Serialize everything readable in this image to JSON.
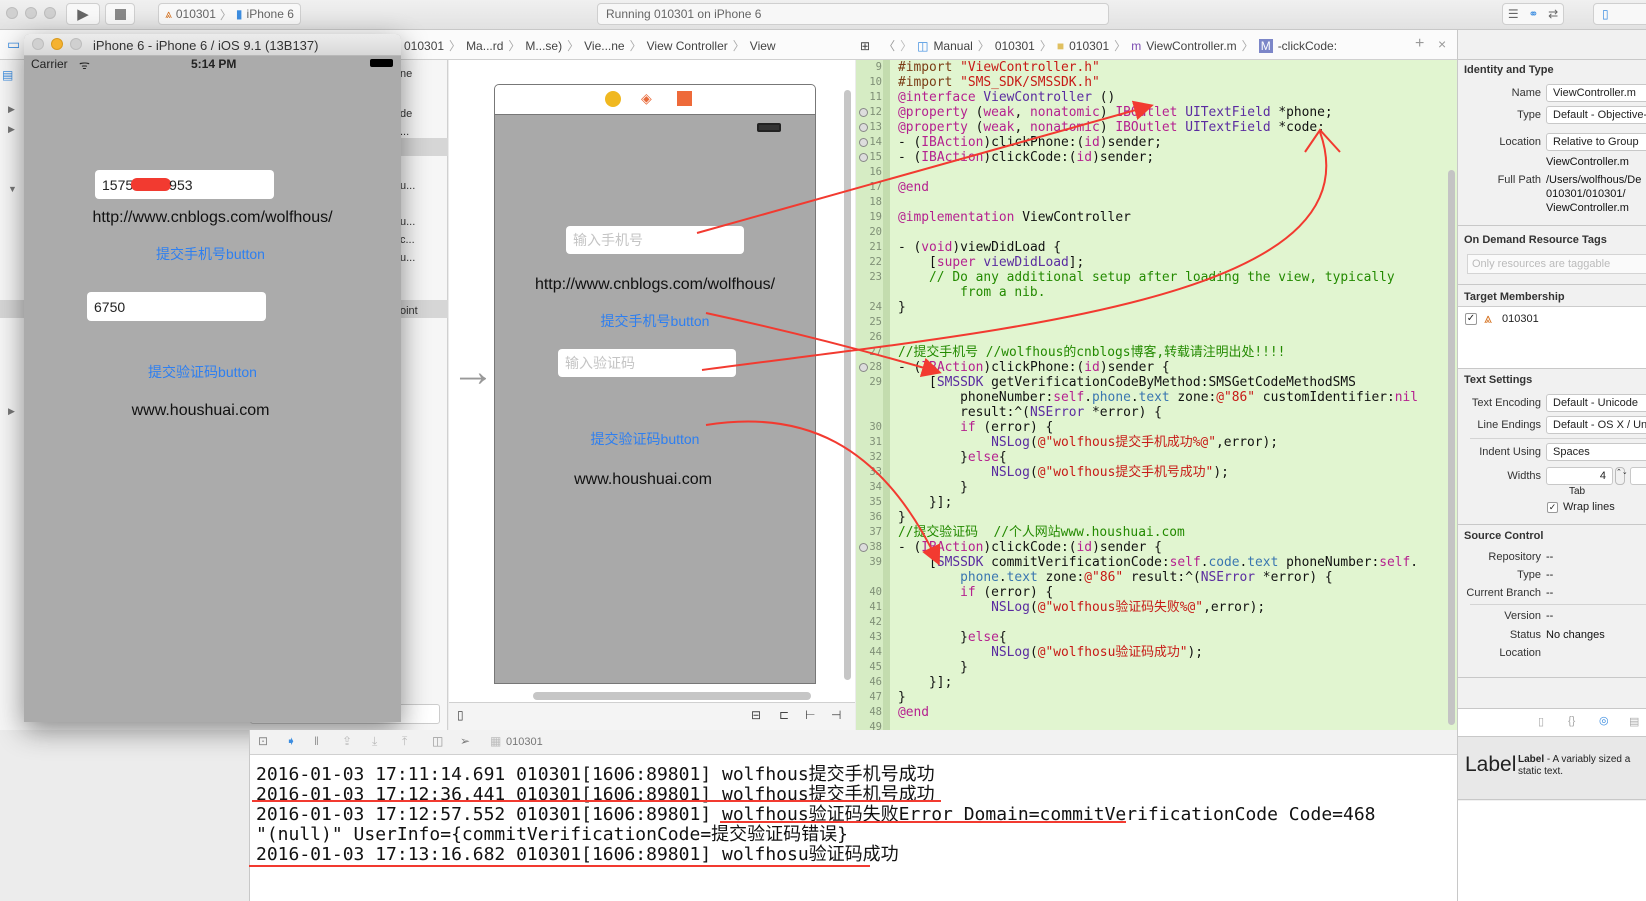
{
  "toolbar": {
    "scheme_project": "010301",
    "scheme_device": "iPhone 6",
    "activity": "Running 010301 on iPhone 6"
  },
  "jumpbar_left": [
    "010301",
    "Ma...rd",
    "M...se)",
    "Vie...ne",
    "View Controller",
    "View"
  ],
  "jumpbar_right": [
    "Manual",
    "010301",
    "010301",
    "ViewController.m",
    "-clickCode:"
  ],
  "navigator_fragments": [
    "ne",
    "de",
    "...",
    "u...",
    "u...",
    "c...",
    "u...",
    "oint"
  ],
  "simulator": {
    "title": "iPhone 6 - iPhone 6 / iOS 9.1 (13B137)",
    "carrier": "Carrier",
    "time": "5:14 PM",
    "phone_value_start": "1575",
    "phone_value_end": "953",
    "url_label": "http://www.cnblogs.com/wolfhous/",
    "phone_button": "提交手机号button",
    "code_value": "6750",
    "code_button": "提交验证码button",
    "site_label": "www.houshuai.com"
  },
  "storyboard": {
    "phone_placeholder": "输入手机号",
    "url_label": "http://www.cnblogs.com/wolfhous/",
    "phone_button": "提交手机号button",
    "code_placeholder": "输入验证码",
    "code_button": "提交验证码button",
    "site_label": "www.houshuai.com"
  },
  "code_lines": [
    {
      "n": "9",
      "tk": [
        [
          "p",
          "#import "
        ],
        [
          "s",
          "\"ViewController.h\""
        ]
      ]
    },
    {
      "n": "10",
      "tk": [
        [
          "p",
          "#import "
        ],
        [
          "s",
          "\"SMS_SDK/SMSSDK.h\""
        ]
      ]
    },
    {
      "n": "11",
      "tk": [
        [
          "k",
          "@interface "
        ],
        [
          "t",
          "ViewController"
        ],
        [
          "n",
          " ()"
        ]
      ]
    },
    {
      "n": "12",
      "m": true,
      "tk": [
        [
          "k",
          "@property"
        ],
        [
          "n",
          " ("
        ],
        [
          "k",
          "weak"
        ],
        [
          "n",
          ", "
        ],
        [
          "k",
          "nonatomic"
        ],
        [
          "n",
          ") "
        ],
        [
          "k",
          "IBOutlet "
        ],
        [
          "t",
          "UITextField"
        ],
        [
          "n",
          " *phone;"
        ]
      ]
    },
    {
      "n": "13",
      "m": true,
      "tk": [
        [
          "k",
          "@property"
        ],
        [
          "n",
          " ("
        ],
        [
          "k",
          "weak"
        ],
        [
          "n",
          ", "
        ],
        [
          "k",
          "nonatomic"
        ],
        [
          "n",
          ") "
        ],
        [
          "k",
          "IBOutlet "
        ],
        [
          "t",
          "UITextField"
        ],
        [
          "n",
          " *code;"
        ]
      ]
    },
    {
      "n": "14",
      "m": true,
      "tk": [
        [
          "n",
          "- ("
        ],
        [
          "k",
          "IBAction"
        ],
        [
          "n",
          ")clickPhone:("
        ],
        [
          "k",
          "id"
        ],
        [
          "n",
          ")sender;"
        ]
      ]
    },
    {
      "n": "15",
      "m": true,
      "tk": [
        [
          "n",
          "- ("
        ],
        [
          "k",
          "IBAction"
        ],
        [
          "n",
          ")clickCode:("
        ],
        [
          "k",
          "id"
        ],
        [
          "n",
          ")sender;"
        ]
      ]
    },
    {
      "n": "16",
      "tk": []
    },
    {
      "n": "17",
      "tk": [
        [
          "k",
          "@end"
        ]
      ]
    },
    {
      "n": "18",
      "tk": []
    },
    {
      "n": "19",
      "tk": [
        [
          "k",
          "@implementation "
        ],
        [
          "n",
          "ViewController"
        ]
      ]
    },
    {
      "n": "20",
      "tk": []
    },
    {
      "n": "21",
      "tk": [
        [
          "n",
          "- ("
        ],
        [
          "k",
          "void"
        ],
        [
          "n",
          ")viewDidLoad {"
        ]
      ]
    },
    {
      "n": "22",
      "tk": [
        [
          "n",
          "    ["
        ],
        [
          "k",
          "super"
        ],
        [
          "n",
          " "
        ],
        [
          "t",
          "viewDidLoad"
        ],
        [
          "n",
          "];"
        ]
      ]
    },
    {
      "n": "23",
      "tk": [
        [
          "c",
          "    // Do any additional setup after loading the view, typically"
        ]
      ]
    },
    {
      "n": "",
      "tk": [
        [
          "c",
          "        from a nib."
        ]
      ]
    },
    {
      "n": "24",
      "tk": [
        [
          "n",
          "}"
        ]
      ]
    },
    {
      "n": "25",
      "tk": []
    },
    {
      "n": "26",
      "tk": []
    },
    {
      "n": "27",
      "tk": [
        [
          "c",
          "//提交手机号 //wolfhous的cnblogs博客,转载请注明出处!!!!"
        ]
      ]
    },
    {
      "n": "28",
      "m": true,
      "tk": [
        [
          "n",
          "- ("
        ],
        [
          "k",
          "IBAction"
        ],
        [
          "n",
          ")clickPhone:("
        ],
        [
          "k",
          "id"
        ],
        [
          "n",
          ")sender {"
        ]
      ]
    },
    {
      "n": "29",
      "tk": [
        [
          "n",
          "    ["
        ],
        [
          "t",
          "SMSSDK"
        ],
        [
          "n",
          " getVerificationCodeByMethod:SMSGetCodeMethodSMS"
        ]
      ]
    },
    {
      "n": "",
      "tk": [
        [
          "n",
          "        phoneNumber:"
        ],
        [
          "k",
          "self"
        ],
        [
          "n",
          "."
        ],
        [
          "i",
          "phone"
        ],
        [
          "n",
          "."
        ],
        [
          "i",
          "text"
        ],
        [
          "n",
          " zone:"
        ],
        [
          "s",
          "@\"86\""
        ],
        [
          "n",
          " customIdentifier:"
        ],
        [
          "k",
          "nil"
        ]
      ]
    },
    {
      "n": "",
      "tk": [
        [
          "n",
          "        result:^("
        ],
        [
          "t",
          "NSError"
        ],
        [
          "n",
          " *error) {"
        ]
      ]
    },
    {
      "n": "30",
      "tk": [
        [
          "n",
          "        "
        ],
        [
          "k",
          "if"
        ],
        [
          "n",
          " (error) {"
        ]
      ]
    },
    {
      "n": "31",
      "tk": [
        [
          "n",
          "            "
        ],
        [
          "t",
          "NSLog"
        ],
        [
          "n",
          "("
        ],
        [
          "s",
          "@\"wolfhous提交手机成功%@\""
        ],
        [
          "n",
          ",error);"
        ]
      ]
    },
    {
      "n": "32",
      "tk": [
        [
          "n",
          "        }"
        ],
        [
          "k",
          "else"
        ],
        [
          "n",
          "{"
        ]
      ]
    },
    {
      "n": "33",
      "tk": [
        [
          "n",
          "            "
        ],
        [
          "t",
          "NSLog"
        ],
        [
          "n",
          "("
        ],
        [
          "s",
          "@\"wolfhous提交手机号成功\""
        ],
        [
          "n",
          ");"
        ]
      ]
    },
    {
      "n": "34",
      "tk": [
        [
          "n",
          "        }"
        ]
      ]
    },
    {
      "n": "35",
      "tk": [
        [
          "n",
          "    }];"
        ]
      ]
    },
    {
      "n": "36",
      "tk": [
        [
          "n",
          "}"
        ]
      ]
    },
    {
      "n": "37",
      "tk": [
        [
          "c",
          "//提交验证码  //个人网站www.houshuai.com"
        ]
      ]
    },
    {
      "n": "38",
      "m": true,
      "tk": [
        [
          "n",
          "- ("
        ],
        [
          "k",
          "IBAction"
        ],
        [
          "n",
          ")clickCode:("
        ],
        [
          "k",
          "id"
        ],
        [
          "n",
          ")sender {"
        ]
      ]
    },
    {
      "n": "39",
      "tk": [
        [
          "n",
          "    ["
        ],
        [
          "t",
          "SMSSDK"
        ],
        [
          "n",
          " commitVerificationCode:"
        ],
        [
          "k",
          "self"
        ],
        [
          "n",
          "."
        ],
        [
          "i",
          "code"
        ],
        [
          "n",
          "."
        ],
        [
          "i",
          "text"
        ],
        [
          "n",
          " phoneNumber:"
        ],
        [
          "k",
          "self"
        ],
        [
          "n",
          "."
        ]
      ]
    },
    {
      "n": "",
      "tk": [
        [
          "n",
          "        "
        ],
        [
          "i",
          "phone"
        ],
        [
          "n",
          "."
        ],
        [
          "i",
          "text"
        ],
        [
          "n",
          " zone:"
        ],
        [
          "s",
          "@\"86\""
        ],
        [
          "n",
          " result:^("
        ],
        [
          "t",
          "NSError"
        ],
        [
          "n",
          " *error) {"
        ]
      ]
    },
    {
      "n": "40",
      "tk": [
        [
          "n",
          "        "
        ],
        [
          "k",
          "if"
        ],
        [
          "n",
          " (error) {"
        ]
      ]
    },
    {
      "n": "41",
      "tk": [
        [
          "n",
          "            "
        ],
        [
          "t",
          "NSLog"
        ],
        [
          "n",
          "("
        ],
        [
          "s",
          "@\"wolfhous验证码失败%@\""
        ],
        [
          "n",
          ",error);"
        ]
      ]
    },
    {
      "n": "42",
      "tk": []
    },
    {
      "n": "43",
      "tk": [
        [
          "n",
          "        }"
        ],
        [
          "k",
          "else"
        ],
        [
          "n",
          "{"
        ]
      ]
    },
    {
      "n": "44",
      "tk": [
        [
          "n",
          "            "
        ],
        [
          "t",
          "NSLog"
        ],
        [
          "n",
          "("
        ],
        [
          "s",
          "@\"wolfhosu验证码成功\""
        ],
        [
          "n",
          ");"
        ]
      ]
    },
    {
      "n": "45",
      "tk": [
        [
          "n",
          "        }"
        ]
      ]
    },
    {
      "n": "46",
      "tk": [
        [
          "n",
          "    }];"
        ]
      ]
    },
    {
      "n": "47",
      "tk": [
        [
          "n",
          "}"
        ]
      ]
    },
    {
      "n": "48",
      "tk": [
        [
          "k",
          "@end"
        ]
      ]
    },
    {
      "n": "49",
      "tk": []
    }
  ],
  "inspector": {
    "identity_title": "Identity and Type",
    "name_label": "Name",
    "name_value": "ViewController.m",
    "type_label": "Type",
    "type_value": "Default - Objective-C Source",
    "location_label": "Location",
    "location_value": "Relative to Group",
    "location_file": "ViewController.m",
    "fullpath_label": "Full Path",
    "fullpath_1": "/Users/wolfhous/De",
    "fullpath_2": "010301/010301/",
    "fullpath_3": "ViewController.m",
    "odr_title": "On Demand Resource Tags",
    "odr_placeholder": "Only resources are taggable",
    "target_title": "Target Membership",
    "target_name": "010301",
    "text_title": "Text Settings",
    "encoding_label": "Text Encoding",
    "encoding_value": "Default - Unicode",
    "endings_label": "Line Endings",
    "endings_value": "Default - OS X / Unix",
    "indent_label": "Indent Using",
    "indent_value": "Spaces",
    "widths_label": "Widths",
    "tab_value": "4",
    "tab_label": "Tab",
    "wrap_label": "Wrap lines",
    "sc_title": "Source Control",
    "repo_label": "Repository",
    "repo_value": "--",
    "sctype_label": "Type",
    "sctype_value": "--",
    "branch_label": "Current Branch",
    "branch_value": "--",
    "version_label": "Version",
    "version_value": "--",
    "status_label": "Status",
    "status_value": "No changes",
    "scloc_label": "Location",
    "lib_big": "Label",
    "lib_title": "Label",
    "lib_desc1": " - A variably sized a",
    "lib_desc2": "static text."
  },
  "debug": {
    "target": "010301"
  },
  "console_lines": [
    "2016-01-03 17:11:14.691 010301[1606:89801] wolfhous提交手机号成功",
    "2016-01-03 17:12:36.441 010301[1606:89801] wolfhous提交手机号成功",
    "2016-01-03 17:12:57.552 010301[1606:89801] wolfhous验证码失败Error Domain=commitVerificationCode Code=468",
    "\"(null)\" UserInfo={commitVerificationCode=提交验证码错误}",
    "2016-01-03 17:13:16.682 010301[1606:89801] wolfhosu验证码成功"
  ],
  "colors": {
    "annotation": "#f23a30",
    "code_bg": "#e1f5d0",
    "link_blue": "#2e7ff0"
  }
}
